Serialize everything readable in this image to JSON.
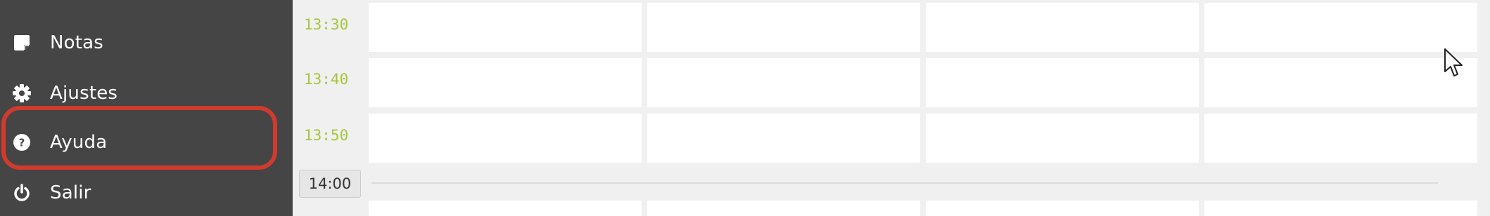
{
  "sidebar": {
    "items": [
      {
        "label": "Notas",
        "icon": "note-icon"
      },
      {
        "label": "Ajustes",
        "icon": "gear-icon"
      },
      {
        "label": "Ayuda",
        "icon": "help-circle-icon"
      },
      {
        "label": "Salir",
        "icon": "power-icon"
      }
    ],
    "highlighted_item": "Ayuda"
  },
  "calendar": {
    "time_slots": [
      "13:30",
      "13:40",
      "13:50"
    ],
    "hour_marker": "14:00",
    "columns": 4
  },
  "colors": {
    "sidebar_bg": "#454545",
    "time_label": "#a5c63b",
    "highlight_outline": "#d13a2e",
    "calendar_bg": "#f0f0f0"
  }
}
